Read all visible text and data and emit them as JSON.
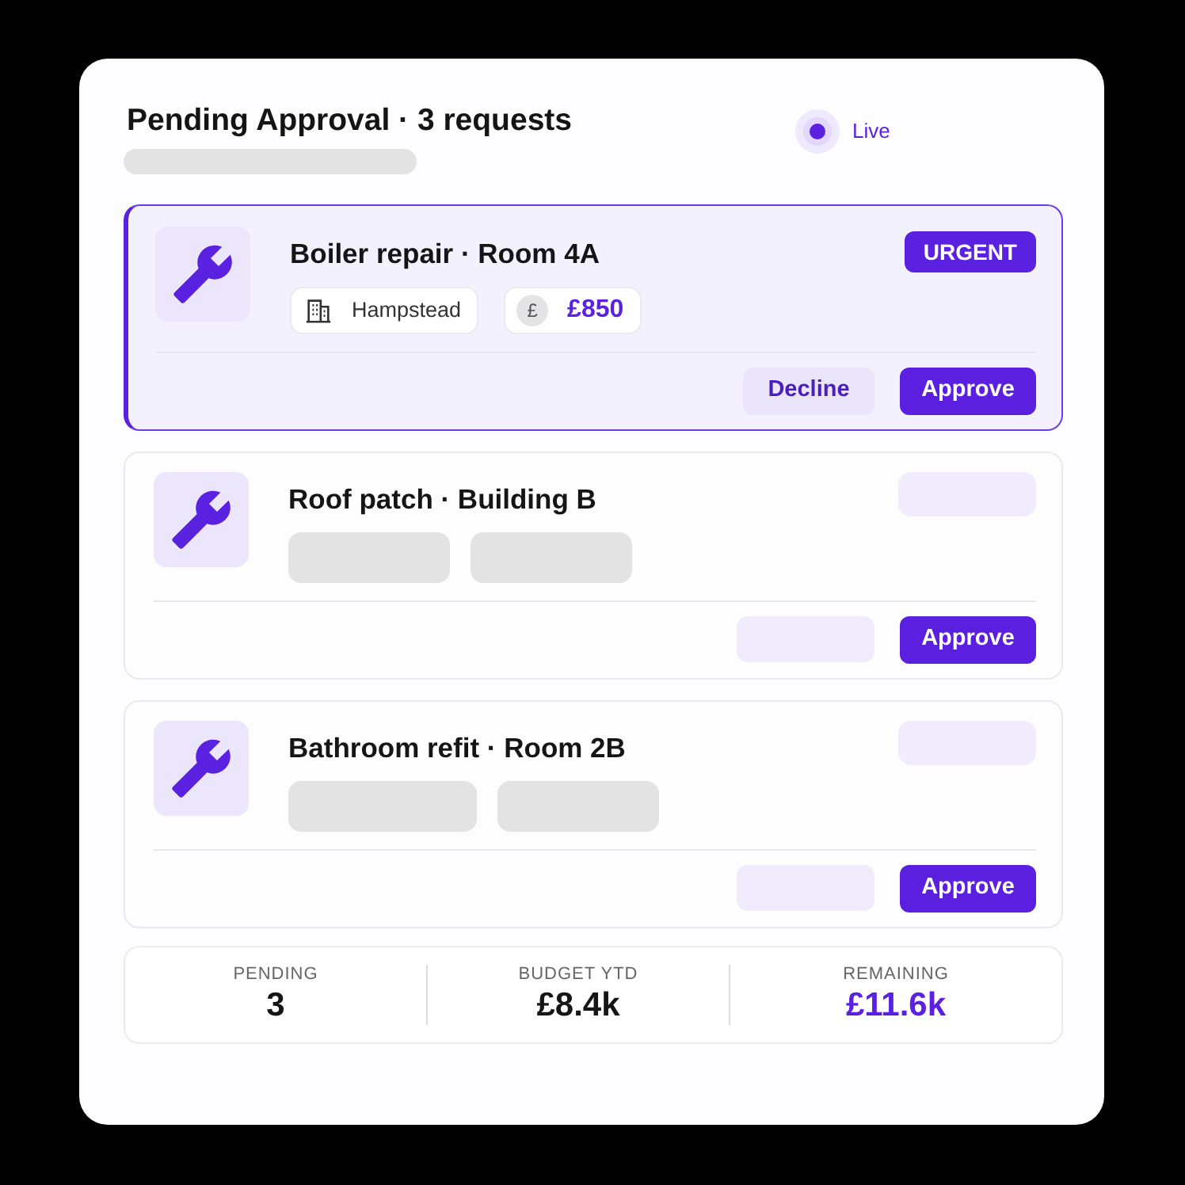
{
  "header": {
    "title": "Pending Approval · 3 requests",
    "subtitle_loading": true,
    "status": {
      "label": "Live",
      "on": true
    }
  },
  "requests": [
    {
      "title": "Boiler repair · Room 4A",
      "selected": true,
      "loading": false,
      "badge": "URGENT",
      "location": "Hampstead",
      "currency_symbol": "£",
      "amount": "£850",
      "actions": [
        {
          "kind": "secondary",
          "label": "Decline"
        },
        {
          "kind": "primary",
          "label": "Approve"
        }
      ]
    },
    {
      "title": "Roof patch · Building B",
      "selected": false,
      "loading": true,
      "actions": [
        {
          "kind": "skeleton"
        },
        {
          "kind": "primary",
          "label": "Approve"
        }
      ]
    },
    {
      "title": "Bathroom refit · Room 2B",
      "selected": false,
      "loading": true,
      "actions": [
        {
          "kind": "skeleton"
        },
        {
          "kind": "primary",
          "label": "Approve"
        }
      ]
    }
  ],
  "stats": [
    {
      "label": "PENDING",
      "value": "3",
      "accent": false
    },
    {
      "label": "BUDGET YTD",
      "value": "£8.4k",
      "accent": false
    },
    {
      "label": "REMAINING",
      "value": "£11.6k",
      "accent": true
    }
  ]
}
